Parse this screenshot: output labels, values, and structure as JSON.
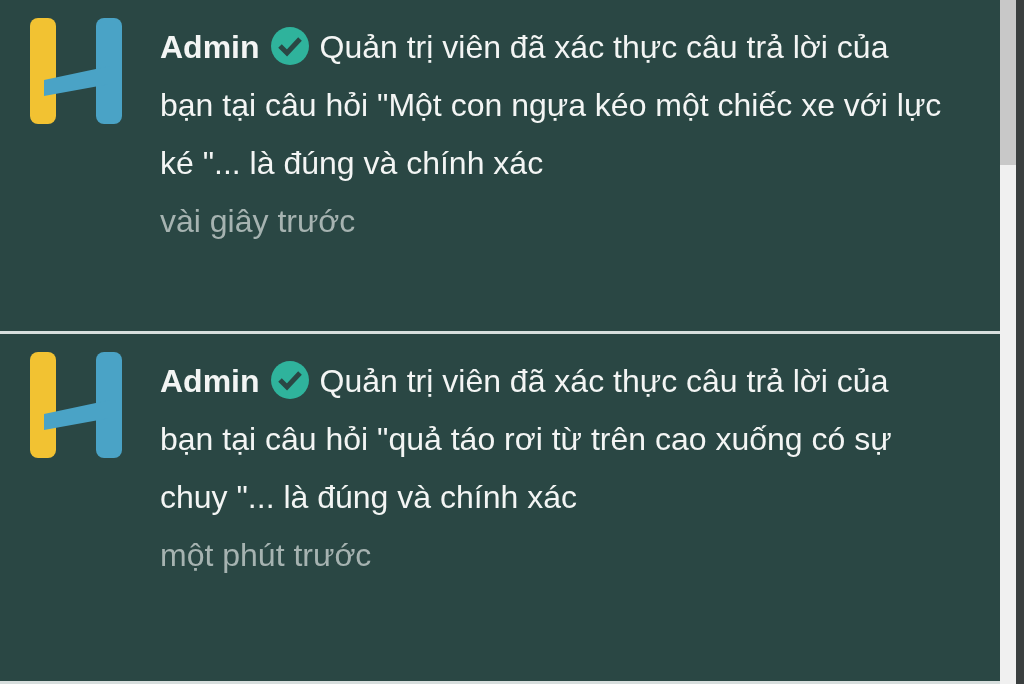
{
  "notifications": [
    {
      "author": "Admin",
      "verified": true,
      "message": "Quản trị viên đã xác thực câu trả lời của bạn tại câu hỏi \"Một con ngựa kéo một chiếc xe với lực ké \"... là đúng và chính xác",
      "time": "vài giây trước"
    },
    {
      "author": "Admin",
      "verified": true,
      "message": "Quản trị viên đã xác thực câu trả lời của bạn tại câu hỏi \"quả táo rơi từ trên cao xuống có sự chuy \"... là đúng và chính xác",
      "time": "một phút trước"
    }
  ]
}
